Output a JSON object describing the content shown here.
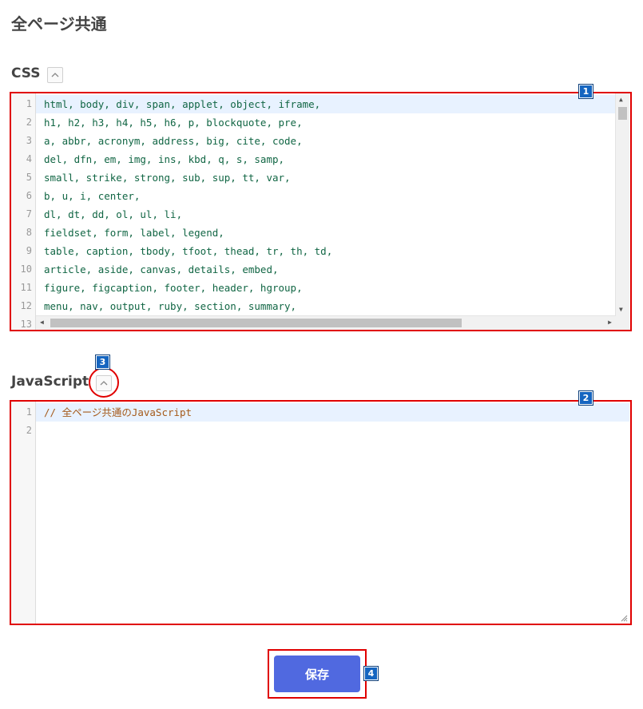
{
  "page": {
    "title": "全ページ共通"
  },
  "css_section": {
    "label": "CSS",
    "badge": "1",
    "lines": [
      {
        "no": "1",
        "text": "html, body, div, span, applet, object, iframe,"
      },
      {
        "no": "2",
        "text": "h1, h2, h3, h4, h5, h6, p, blockquote, pre,"
      },
      {
        "no": "3",
        "text": "a, abbr, acronym, address, big, cite, code,"
      },
      {
        "no": "4",
        "text": "del, dfn, em, img, ins, kbd, q, s, samp,"
      },
      {
        "no": "5",
        "text": "small, strike, strong, sub, sup, tt, var,"
      },
      {
        "no": "6",
        "text": "b, u, i, center,"
      },
      {
        "no": "7",
        "text": "dl, dt, dd, ol, ul, li,"
      },
      {
        "no": "8",
        "text": "fieldset, form, label, legend,"
      },
      {
        "no": "9",
        "text": "table, caption, tbody, tfoot, thead, tr, th, td,"
      },
      {
        "no": "10",
        "text": "article, aside, canvas, details, embed,"
      },
      {
        "no": "11",
        "text": "figure, figcaption, footer, header, hgroup,"
      },
      {
        "no": "12",
        "text": "menu, nav, output, ruby, section, summary,"
      },
      {
        "no": "13",
        "text": ""
      }
    ]
  },
  "js_section": {
    "label": "JavaScript",
    "badge_editor": "2",
    "badge_collapse": "3",
    "lines": [
      {
        "no": "1",
        "text": "// 全ページ共通のJavaScript"
      },
      {
        "no": "2",
        "text": ""
      }
    ]
  },
  "footer": {
    "save_label": "保存",
    "badge": "4"
  },
  "colors": {
    "highlight": "#e00000",
    "badge": "#1565c0",
    "save_button": "#5069e0",
    "code_css": "#116644",
    "code_comment": "#a55a1a"
  }
}
